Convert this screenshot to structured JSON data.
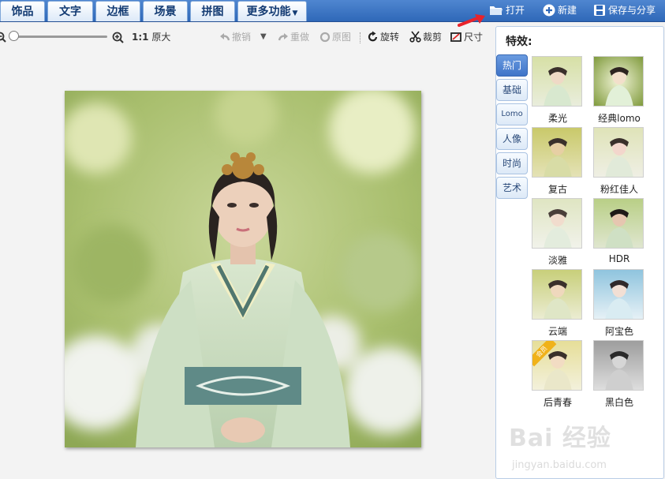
{
  "menu": {
    "tabs": [
      {
        "label": "饰品"
      },
      {
        "label": "文字"
      },
      {
        "label": "边框"
      },
      {
        "label": "场景"
      },
      {
        "label": "拼图"
      },
      {
        "label": "更多功能"
      }
    ],
    "actions": {
      "open": "打开",
      "new": "新建",
      "save_share": "保存与分享"
    }
  },
  "toolbar": {
    "zoom_ratio": "1:1",
    "original_size": "原大",
    "undo": "撤销",
    "redo": "重做",
    "original": "原图",
    "rotate": "旋转",
    "crop": "裁剪",
    "size": "尺寸"
  },
  "panel": {
    "title": "特效:",
    "categories": [
      {
        "label": "热门",
        "active": true
      },
      {
        "label": "基础"
      },
      {
        "label": "Lomo"
      },
      {
        "label": "人像"
      },
      {
        "label": "时尚"
      },
      {
        "label": "艺术"
      }
    ],
    "effects": [
      {
        "label": "柔光"
      },
      {
        "label": "经典lomo"
      },
      {
        "label": "复古"
      },
      {
        "label": "粉红佳人"
      },
      {
        "label": "淡雅"
      },
      {
        "label": "HDR"
      },
      {
        "label": "云端"
      },
      {
        "label": "阿宝色"
      },
      {
        "label": "后青春",
        "badge": "会员"
      },
      {
        "label": "黑白色"
      }
    ]
  },
  "watermark": {
    "brand": "Bai 经验",
    "url": "jingyan.baidu.com"
  },
  "colors": {
    "topbar": "#3a73c2",
    "accent": "#3f74c8",
    "tab_text": "#123a72"
  }
}
